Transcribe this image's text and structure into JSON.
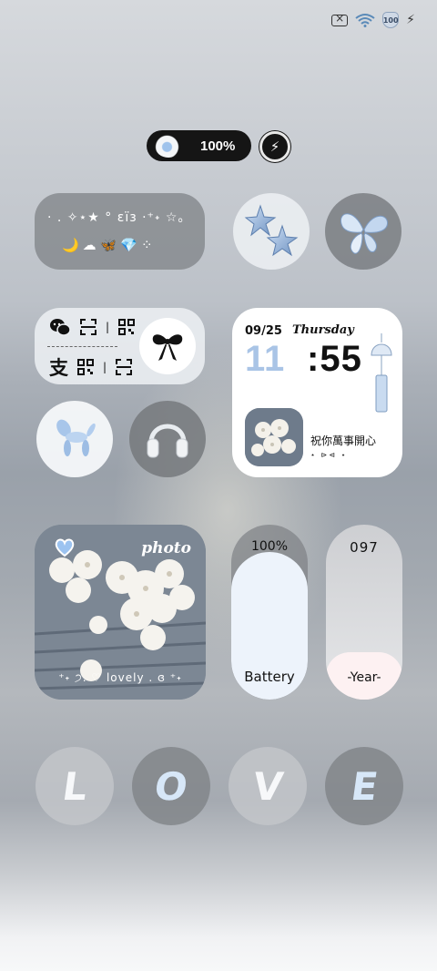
{
  "status_bar": {
    "battery_level": "100",
    "icons": [
      "no-sim-icon",
      "wifi-icon",
      "battery-shield-icon",
      "charging-bolt-icon"
    ]
  },
  "battery_pill": {
    "percent": "100%",
    "icon": "cloud-heart-icon",
    "action_icon": "bolt-icon"
  },
  "decor_widget": {
    "line1": "· . ✧⋆★ ° ɛїɜ ·⁺˖ ☆。",
    "line2": "🌙☁🦋💎⁘"
  },
  "shortcut_widget": {
    "row1": [
      "wechat-icon",
      "scan-icon",
      "qr-code-icon"
    ],
    "row2": [
      "alipay-icon",
      "qr-code-icon",
      "scan-icon"
    ],
    "alipay_glyph": "支",
    "bow_icon": "ribbon-bow-icon"
  },
  "clock_widget": {
    "date": "09/25",
    "day": "Thursday",
    "hour": "11",
    "minute": ":55",
    "wish": "祝你萬事開心",
    "wish_deco": "⋆ ⊳⊲ ⋆"
  },
  "photo_widget": {
    "title": "photo",
    "caption": "⁺˖ ੭. ♡ lovely . ɞ ⁺˖"
  },
  "battery_widget": {
    "percent": "100%",
    "label": "Battery",
    "level": 1.0
  },
  "year_widget": {
    "day_number": "097",
    "label": "-Year-",
    "progress": 0.27
  },
  "love_letters": [
    "L",
    "O",
    "V",
    "E"
  ],
  "colors": {
    "accent_blue": "#a9c4e6",
    "letter_blue": "#d7e7f8",
    "pill_black": "#151515"
  }
}
